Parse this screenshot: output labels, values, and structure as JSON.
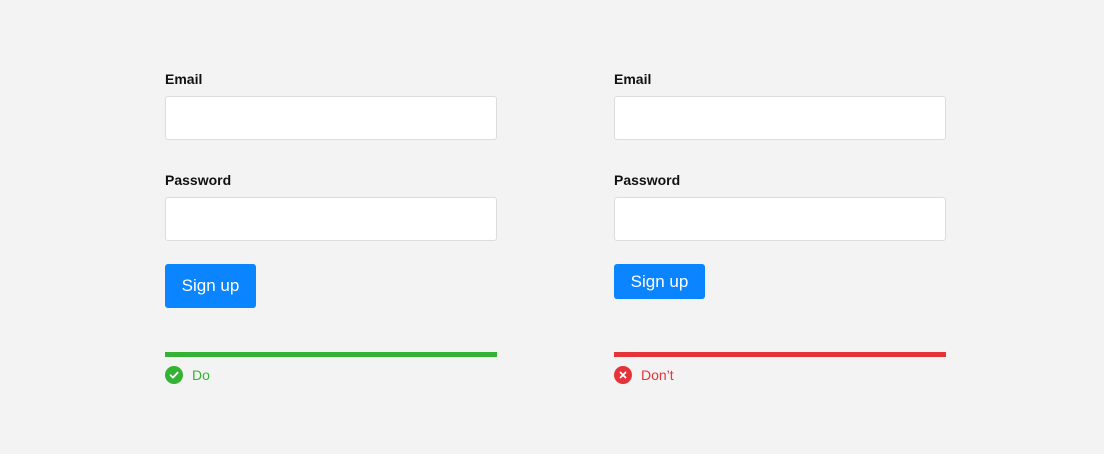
{
  "colors": {
    "background": "#f3f3f3",
    "button": "#0b85ff",
    "do": "#34b233",
    "dont": "#e4343a"
  },
  "do_example": {
    "email_label": "Email",
    "email_value": "",
    "password_label": "Password",
    "password_value": "",
    "button_label": "Sign up",
    "verdict_icon": "check-circle-icon",
    "verdict_label": "Do"
  },
  "dont_example": {
    "email_label": "Email",
    "email_value": "",
    "password_label": "Password",
    "password_value": "",
    "button_label": "Sign up",
    "verdict_icon": "x-circle-icon",
    "verdict_label": "Don’t"
  }
}
